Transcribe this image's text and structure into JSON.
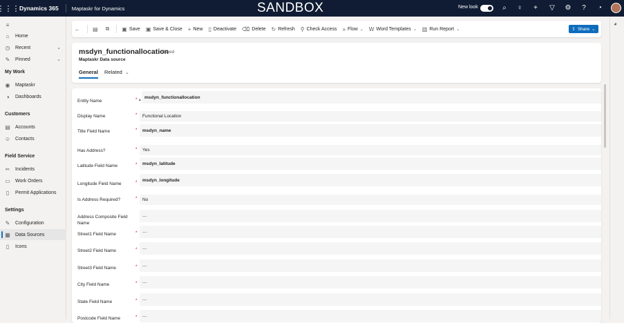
{
  "topbar": {
    "brand": "Dynamics 365",
    "app_name": "Maptaskr for Dynamics",
    "environment": "SANDBOX",
    "new_look_label": "New look",
    "new_look_on": true,
    "icons": [
      "waffle-icon",
      "search-icon",
      "lightbulb-icon",
      "plus-icon",
      "filter-icon",
      "gear-icon",
      "help-icon",
      "copilot-icon",
      "avatar"
    ]
  },
  "sidebar": {
    "menu_icon": "hamburger-icon",
    "items": [
      {
        "label": "Home",
        "icon": "home-icon"
      },
      {
        "label": "Recent",
        "icon": "clock-icon",
        "chevron": true
      },
      {
        "label": "Pinned",
        "icon": "pin-icon",
        "chevron": true
      }
    ],
    "sections": [
      {
        "title": "My Work",
        "items": [
          {
            "label": "Maptaskr",
            "icon": "eye-icon"
          },
          {
            "label": "Dashboards",
            "icon": "dashboard-icon"
          }
        ]
      },
      {
        "title": "Customers",
        "items": [
          {
            "label": "Accounts",
            "icon": "building-icon"
          },
          {
            "label": "Contacts",
            "icon": "person-icon"
          }
        ]
      },
      {
        "title": "Field Service",
        "items": [
          {
            "label": "Incidents",
            "icon": "wrench-icon"
          },
          {
            "label": "Work Orders",
            "icon": "clipboard-icon"
          },
          {
            "label": "Permit Applications",
            "icon": "document-icon"
          }
        ]
      },
      {
        "title": "Settings",
        "items": [
          {
            "label": "Configuration",
            "icon": "pencil-icon"
          },
          {
            "label": "Data Sources",
            "icon": "database-icon",
            "active": true
          },
          {
            "label": "Icons",
            "icon": "document-icon"
          }
        ]
      }
    ]
  },
  "commandbar": {
    "back_icon": "back-arrow-icon",
    "record_icon": "record-icon",
    "popout_icon": "popout-icon",
    "buttons": [
      {
        "label": "Save",
        "icon": "save-icon"
      },
      {
        "label": "Save & Close",
        "icon": "save-close-icon"
      },
      {
        "label": "New",
        "icon": "plus-icon"
      },
      {
        "label": "Deactivate",
        "icon": "deactivate-icon"
      },
      {
        "label": "Delete",
        "icon": "delete-icon"
      },
      {
        "label": "Refresh",
        "icon": "refresh-icon"
      },
      {
        "label": "Check Access",
        "icon": "check-access-icon"
      },
      {
        "label": "Flow",
        "icon": "flow-icon",
        "dropdown": true
      },
      {
        "label": "Word Templates",
        "icon": "word-icon",
        "dropdown": true
      },
      {
        "label": "Run Report",
        "icon": "report-icon",
        "dropdown": true
      }
    ],
    "share_label": "Share",
    "share_chevron": "chevron-down-icon"
  },
  "record": {
    "title": "msdyn_functionallocation",
    "status": "- Saved",
    "subtitle": "Maptaskr Data source",
    "tabs": [
      {
        "label": "General",
        "active": true
      },
      {
        "label": "Related",
        "dropdown": true
      }
    ]
  },
  "form": {
    "fields": [
      {
        "label": "Entity Name",
        "required": true,
        "locked": true,
        "value": "msdyn_functionallocation",
        "bold": true,
        "wide": false
      },
      {
        "label": "Display Name",
        "required": true,
        "value": "Functional Location",
        "bold": false,
        "wide": true
      },
      {
        "label": "Title Field Name",
        "required": true,
        "value": "msdyn_name",
        "bold": true,
        "wide": false
      },
      {
        "label": "Has Address?",
        "required": true,
        "value": "Yes",
        "bold": false,
        "wide": true
      },
      {
        "label": "Latitude Field Name",
        "required": true,
        "value": "msdyn_latitude",
        "bold": true,
        "wide": false
      },
      {
        "label": "Longitude Field Name",
        "required": true,
        "value": "msdyn_longitude",
        "bold": true,
        "wide": false
      },
      {
        "label": "Is Address Required?",
        "required": true,
        "value": "No",
        "bold": false,
        "wide": true
      },
      {
        "label": "Address Composite Field Name",
        "required": false,
        "value": "---",
        "bold": false,
        "wide": false,
        "muted": true
      },
      {
        "label": "Street1 Field Name",
        "required": true,
        "value": "---",
        "bold": false,
        "wide": false,
        "muted": true
      },
      {
        "label": "Street2 Field Name",
        "required": true,
        "value": "---",
        "bold": false,
        "wide": false,
        "muted": true
      },
      {
        "label": "Street3 Field Name",
        "required": true,
        "value": "---",
        "bold": false,
        "wide": false,
        "muted": true
      },
      {
        "label": "City Field Name",
        "required": true,
        "value": "---",
        "bold": false,
        "wide": false,
        "muted": true
      },
      {
        "label": "State Field Name",
        "required": true,
        "value": "---",
        "bold": false,
        "wide": false,
        "muted": true
      },
      {
        "label": "Postcode Field Name",
        "required": true,
        "value": "---",
        "bold": false,
        "wide": false,
        "muted": true
      }
    ]
  },
  "colors": {
    "topbar": "#0f1c33",
    "accent": "#0f6cbd",
    "required": "#c50f1f",
    "field_bg": "#f5f5f5"
  }
}
